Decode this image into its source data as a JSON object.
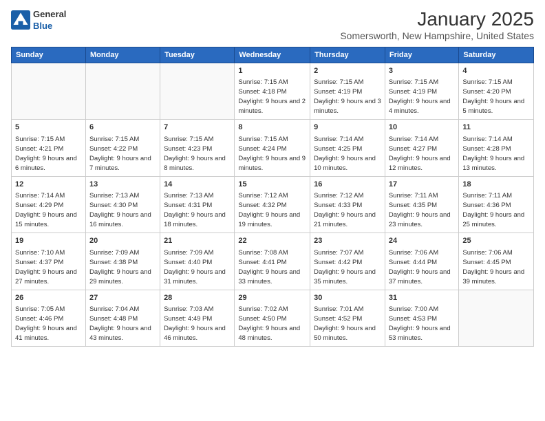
{
  "logo": {
    "general": "General",
    "blue": "Blue"
  },
  "header": {
    "month": "January 2025",
    "location": "Somersworth, New Hampshire, United States"
  },
  "weekdays": [
    "Sunday",
    "Monday",
    "Tuesday",
    "Wednesday",
    "Thursday",
    "Friday",
    "Saturday"
  ],
  "weeks": [
    [
      {
        "day": "",
        "sunrise": "",
        "sunset": "",
        "daylight": ""
      },
      {
        "day": "",
        "sunrise": "",
        "sunset": "",
        "daylight": ""
      },
      {
        "day": "",
        "sunrise": "",
        "sunset": "",
        "daylight": ""
      },
      {
        "day": "1",
        "sunrise": "7:15 AM",
        "sunset": "4:18 PM",
        "daylight": "9 hours and 2 minutes."
      },
      {
        "day": "2",
        "sunrise": "7:15 AM",
        "sunset": "4:19 PM",
        "daylight": "9 hours and 3 minutes."
      },
      {
        "day": "3",
        "sunrise": "7:15 AM",
        "sunset": "4:19 PM",
        "daylight": "9 hours and 4 minutes."
      },
      {
        "day": "4",
        "sunrise": "7:15 AM",
        "sunset": "4:20 PM",
        "daylight": "9 hours and 5 minutes."
      }
    ],
    [
      {
        "day": "5",
        "sunrise": "7:15 AM",
        "sunset": "4:21 PM",
        "daylight": "9 hours and 6 minutes."
      },
      {
        "day": "6",
        "sunrise": "7:15 AM",
        "sunset": "4:22 PM",
        "daylight": "9 hours and 7 minutes."
      },
      {
        "day": "7",
        "sunrise": "7:15 AM",
        "sunset": "4:23 PM",
        "daylight": "9 hours and 8 minutes."
      },
      {
        "day": "8",
        "sunrise": "7:15 AM",
        "sunset": "4:24 PM",
        "daylight": "9 hours and 9 minutes."
      },
      {
        "day": "9",
        "sunrise": "7:14 AM",
        "sunset": "4:25 PM",
        "daylight": "9 hours and 10 minutes."
      },
      {
        "day": "10",
        "sunrise": "7:14 AM",
        "sunset": "4:27 PM",
        "daylight": "9 hours and 12 minutes."
      },
      {
        "day": "11",
        "sunrise": "7:14 AM",
        "sunset": "4:28 PM",
        "daylight": "9 hours and 13 minutes."
      }
    ],
    [
      {
        "day": "12",
        "sunrise": "7:14 AM",
        "sunset": "4:29 PM",
        "daylight": "9 hours and 15 minutes."
      },
      {
        "day": "13",
        "sunrise": "7:13 AM",
        "sunset": "4:30 PM",
        "daylight": "9 hours and 16 minutes."
      },
      {
        "day": "14",
        "sunrise": "7:13 AM",
        "sunset": "4:31 PM",
        "daylight": "9 hours and 18 minutes."
      },
      {
        "day": "15",
        "sunrise": "7:12 AM",
        "sunset": "4:32 PM",
        "daylight": "9 hours and 19 minutes."
      },
      {
        "day": "16",
        "sunrise": "7:12 AM",
        "sunset": "4:33 PM",
        "daylight": "9 hours and 21 minutes."
      },
      {
        "day": "17",
        "sunrise": "7:11 AM",
        "sunset": "4:35 PM",
        "daylight": "9 hours and 23 minutes."
      },
      {
        "day": "18",
        "sunrise": "7:11 AM",
        "sunset": "4:36 PM",
        "daylight": "9 hours and 25 minutes."
      }
    ],
    [
      {
        "day": "19",
        "sunrise": "7:10 AM",
        "sunset": "4:37 PM",
        "daylight": "9 hours and 27 minutes."
      },
      {
        "day": "20",
        "sunrise": "7:09 AM",
        "sunset": "4:38 PM",
        "daylight": "9 hours and 29 minutes."
      },
      {
        "day": "21",
        "sunrise": "7:09 AM",
        "sunset": "4:40 PM",
        "daylight": "9 hours and 31 minutes."
      },
      {
        "day": "22",
        "sunrise": "7:08 AM",
        "sunset": "4:41 PM",
        "daylight": "9 hours and 33 minutes."
      },
      {
        "day": "23",
        "sunrise": "7:07 AM",
        "sunset": "4:42 PM",
        "daylight": "9 hours and 35 minutes."
      },
      {
        "day": "24",
        "sunrise": "7:06 AM",
        "sunset": "4:44 PM",
        "daylight": "9 hours and 37 minutes."
      },
      {
        "day": "25",
        "sunrise": "7:06 AM",
        "sunset": "4:45 PM",
        "daylight": "9 hours and 39 minutes."
      }
    ],
    [
      {
        "day": "26",
        "sunrise": "7:05 AM",
        "sunset": "4:46 PM",
        "daylight": "9 hours and 41 minutes."
      },
      {
        "day": "27",
        "sunrise": "7:04 AM",
        "sunset": "4:48 PM",
        "daylight": "9 hours and 43 minutes."
      },
      {
        "day": "28",
        "sunrise": "7:03 AM",
        "sunset": "4:49 PM",
        "daylight": "9 hours and 46 minutes."
      },
      {
        "day": "29",
        "sunrise": "7:02 AM",
        "sunset": "4:50 PM",
        "daylight": "9 hours and 48 minutes."
      },
      {
        "day": "30",
        "sunrise": "7:01 AM",
        "sunset": "4:52 PM",
        "daylight": "9 hours and 50 minutes."
      },
      {
        "day": "31",
        "sunrise": "7:00 AM",
        "sunset": "4:53 PM",
        "daylight": "9 hours and 53 minutes."
      },
      {
        "day": "",
        "sunrise": "",
        "sunset": "",
        "daylight": ""
      }
    ]
  ]
}
